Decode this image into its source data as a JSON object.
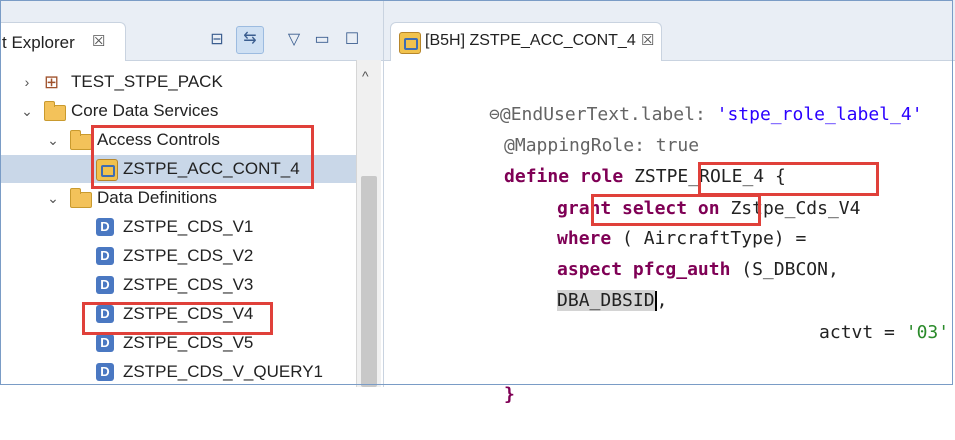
{
  "explorer": {
    "title": "t Explorer",
    "close": "☒",
    "toolbar": {
      "collapse": "⊟",
      "link": "⇆",
      "menu": "▽",
      "minimize": "▭",
      "maximize": "☐"
    },
    "tree": [
      {
        "indent": 0,
        "arrow": "›",
        "icon": "package",
        "label": "TEST_STPE_PACK"
      },
      {
        "indent": 0,
        "arrow": "⌄",
        "icon": "folder",
        "label": "Core Data Services"
      },
      {
        "indent": 1,
        "arrow": "⌄",
        "icon": "folder",
        "label": "Access Controls"
      },
      {
        "indent": 2,
        "arrow": "",
        "icon": "acl",
        "label": "ZSTPE_ACC_CONT_4",
        "selected": true
      },
      {
        "indent": 1,
        "arrow": "⌄",
        "icon": "folder",
        "label": "Data Definitions"
      },
      {
        "indent": 2,
        "arrow": "",
        "icon": "ddl",
        "label": "ZSTPE_CDS_V1"
      },
      {
        "indent": 2,
        "arrow": "",
        "icon": "ddl",
        "label": "ZSTPE_CDS_V2"
      },
      {
        "indent": 2,
        "arrow": "",
        "icon": "ddl",
        "label": "ZSTPE_CDS_V3"
      },
      {
        "indent": 2,
        "arrow": "",
        "icon": "ddl",
        "label": "ZSTPE_CDS_V4"
      },
      {
        "indent": 2,
        "arrow": "",
        "icon": "ddl",
        "label": "ZSTPE_CDS_V5"
      },
      {
        "indent": 2,
        "arrow": "",
        "icon": "ddl",
        "label": "ZSTPE_CDS_V_QUERY1"
      }
    ],
    "scroll_up": "^"
  },
  "editor": {
    "tab_title": "[B5H] ZSTPE_ACC_CONT_4",
    "tab_close": "☒",
    "fold_marker": "⊖",
    "code": {
      "l1_annotation": "@EndUserText.label: ",
      "l1_string": "'stpe_role_label_4'",
      "l2_annotation": "@MappingRole: true",
      "l3_define": "define role",
      "l3_name": " ZSTPE_ROLE_4 {",
      "l4_grant": "grant select on",
      "l4_entity": "Zstpe_Cds_V4",
      "l5_where": "where",
      "l5_paren": " ( ",
      "l5_field": "AircraftType",
      "l5_rest": ") =",
      "l6_aspect": "aspect pfcg_auth",
      "l6_rest": " (S_DBCON,",
      "l7_field": "DBA_DBSID",
      "l7_comma": ",",
      "l8_actvt": "actvt = ",
      "l8_value": "'03'",
      "l8_end": " );",
      "l9_close": "}"
    }
  },
  "colors": {
    "highlight_box": "#e0403a",
    "keyword": "#7f0055",
    "string": "#2a00ff"
  }
}
